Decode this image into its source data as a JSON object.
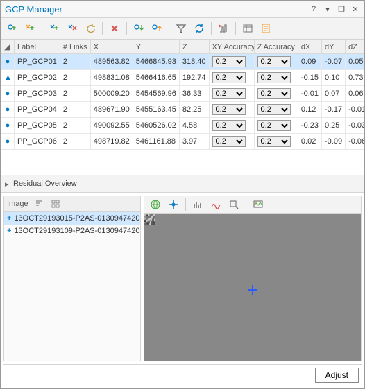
{
  "window": {
    "title": "GCP Manager",
    "help_icon": "?",
    "dropdown_icon": "▾",
    "restore_icon": "❐",
    "close_icon": "✕"
  },
  "table": {
    "headers": {
      "icon": "",
      "label": "Label",
      "links": "# Links",
      "x": "X",
      "y": "Y",
      "z": "Z",
      "xyacc": "XY Accuracy",
      "zacc": "Z Accuracy",
      "dx": "dX",
      "dy": "dY",
      "dz": "dZ"
    },
    "acc_options": [
      "0.2"
    ],
    "rows": [
      {
        "icon": "●",
        "label": "PP_GCP01",
        "links": "2",
        "x": "489563.82",
        "y": "5466845.93",
        "z": "318.40",
        "xyacc": "0.2",
        "zacc": "0.2",
        "dx": "0.09",
        "dy": "-0.07",
        "dz": "0.05",
        "selected": true
      },
      {
        "icon": "▲",
        "label": "PP_GCP02",
        "links": "2",
        "x": "498831.08",
        "y": "5466416.65",
        "z": "192.74",
        "xyacc": "0.2",
        "zacc": "0.2",
        "dx": "-0.15",
        "dy": "0.10",
        "dz": "0.73",
        "selected": false
      },
      {
        "icon": "●",
        "label": "PP_GCP03",
        "links": "2",
        "x": "500009.20",
        "y": "5454569.96",
        "z": "36.33",
        "xyacc": "0.2",
        "zacc": "0.2",
        "dx": "-0.01",
        "dy": "0.07",
        "dz": "0.06",
        "selected": false
      },
      {
        "icon": "●",
        "label": "PP_GCP04",
        "links": "2",
        "x": "489671.90",
        "y": "5455163.45",
        "z": "82.25",
        "xyacc": "0.2",
        "zacc": "0.2",
        "dx": "0.12",
        "dy": "-0.17",
        "dz": "-0.01",
        "selected": false
      },
      {
        "icon": "●",
        "label": "PP_GCP05",
        "links": "2",
        "x": "490092.55",
        "y": "5460526.02",
        "z": "4.58",
        "xyacc": "0.2",
        "zacc": "0.2",
        "dx": "-0.23",
        "dy": "0.25",
        "dz": "-0.03",
        "selected": false
      },
      {
        "icon": "●",
        "label": "PP_GCP06",
        "links": "2",
        "x": "498719.82",
        "y": "5461161.88",
        "z": "3.97",
        "xyacc": "0.2",
        "zacc": "0.2",
        "dx": "0.02",
        "dy": "-0.09",
        "dz": "-0.06",
        "selected": false
      }
    ]
  },
  "residual": {
    "title": "Residual Overview",
    "chevron": "▸"
  },
  "image_panel": {
    "header": "Image",
    "items": [
      {
        "name": "13OCT29193015-P2AS-0130947420",
        "selected": true
      },
      {
        "name": "13OCT29193109-P2AS-0130947420",
        "selected": false
      }
    ]
  },
  "footer": {
    "adjust": "Adjust"
  }
}
